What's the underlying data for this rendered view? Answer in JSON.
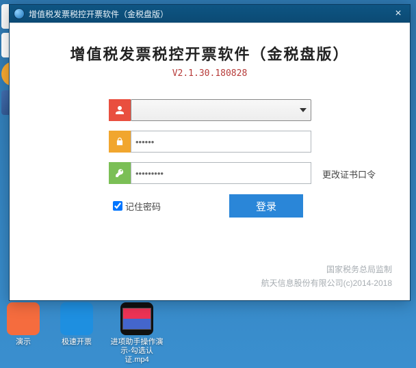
{
  "window": {
    "title": "增值税发票税控开票软件（金税盘版）",
    "close_glyph": "×"
  },
  "app": {
    "name": "增值税发票税控开票软件（金税盘版）",
    "version": "V2.1.30.180828"
  },
  "form": {
    "username_value": "",
    "password_value": "******",
    "cert_value": "*********",
    "change_cert_label": "更改证书口令",
    "remember_label": "记住密码",
    "login_label": "登录"
  },
  "footer": {
    "line1": "国家税务总局监制",
    "line2": "航天信息股份有限公司(c)2014-2018"
  },
  "desktop_icons": {
    "b1": "演示",
    "b2": "极速开票",
    "b3": "进项助手操作演示-勾选认证.mp4"
  }
}
